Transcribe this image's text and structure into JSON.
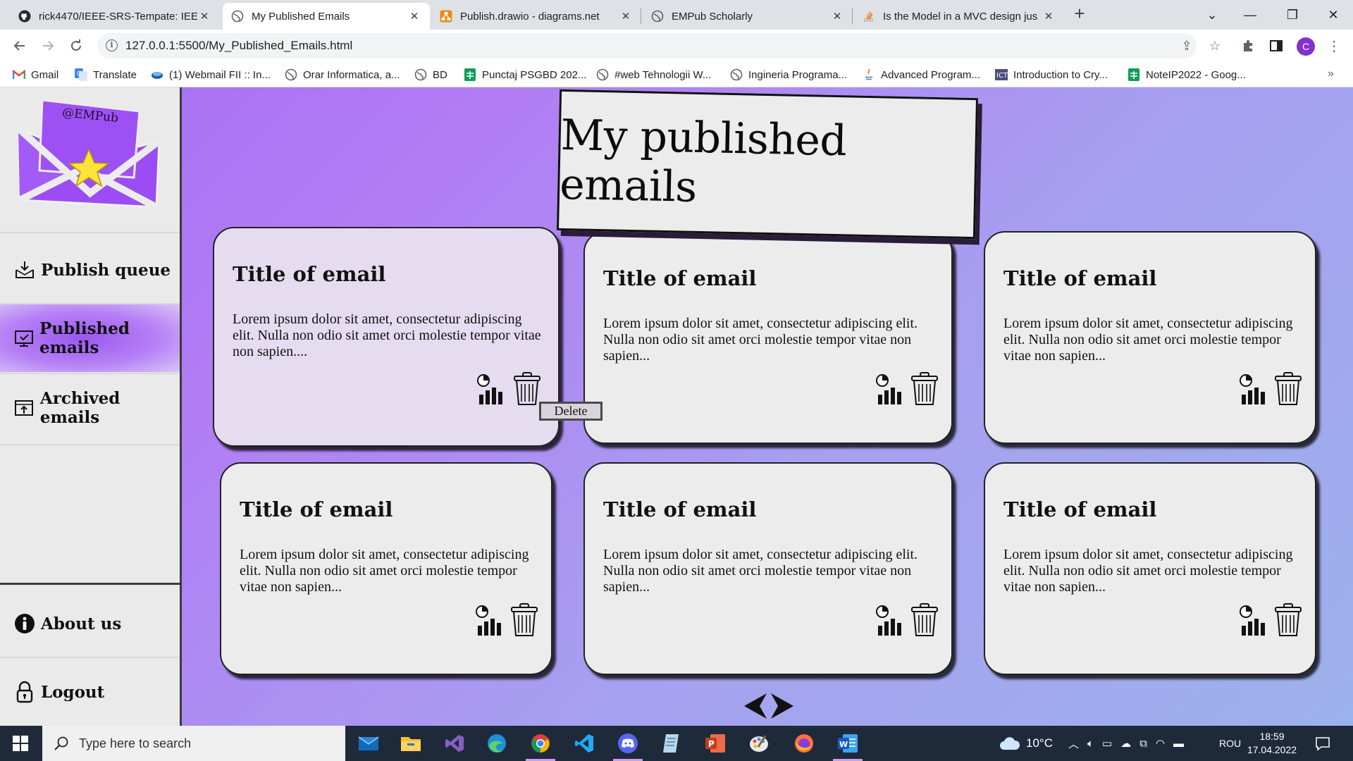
{
  "browser": {
    "tabs": [
      {
        "title": "rick4470/IEEE-SRS-Tempate: IEEE",
        "active": false,
        "icon": "github-icon"
      },
      {
        "title": "My Published Emails",
        "active": true,
        "icon": "globe-icon"
      },
      {
        "title": "Publish.drawio - diagrams.net",
        "active": false,
        "icon": "drawio-icon"
      },
      {
        "title": "EMPub Scholarly",
        "active": false,
        "icon": "globe-icon"
      },
      {
        "title": "Is the Model in a MVC design jus",
        "active": false,
        "icon": "stackoverflow-icon"
      }
    ],
    "url": "127.0.0.1:5500/My_Published_Emails.html",
    "profile_initial": "C",
    "bookmarks": [
      {
        "label": "Gmail",
        "icon": "gmail-icon"
      },
      {
        "label": "Translate",
        "icon": "translate-icon"
      },
      {
        "label": "(1) Webmail FII :: In...",
        "icon": "webmail-icon"
      },
      {
        "label": "Orar Informatica, a...",
        "icon": "globe-icon"
      },
      {
        "label": "BD",
        "icon": "globe-icon"
      },
      {
        "label": "Punctaj PSGBD 202...",
        "icon": "sheets-icon"
      },
      {
        "label": "#web Tehnologii W...",
        "icon": "globe-icon"
      },
      {
        "label": "Ingineria Programa...",
        "icon": "globe-icon"
      },
      {
        "label": "Advanced Program...",
        "icon": "java-icon"
      },
      {
        "label": "Introduction to Cry...",
        "icon": "crypto-icon"
      },
      {
        "label": "NoteIP2022 - Goog...",
        "icon": "sheets-icon"
      }
    ]
  },
  "app": {
    "logo_text": "@EMPub",
    "page_title": "My published emails",
    "sidebar": {
      "nav": [
        {
          "label": "Publish queue",
          "icon": "inbox-download-icon",
          "active": false
        },
        {
          "label": "Published emails",
          "icon": "monitor-check-icon",
          "active": true
        },
        {
          "label": "Archived emails",
          "icon": "archive-upload-icon",
          "active": false
        }
      ],
      "bottom": [
        {
          "label": "About us",
          "icon": "info-icon"
        },
        {
          "label": "Logout",
          "icon": "lock-icon"
        }
      ]
    },
    "cards": [
      {
        "title": "Title of email",
        "body": "Lorem ipsum dolor sit amet, consectetur adipiscing elit. Nulla non odio sit amet orci molestie tempor vitae non sapien....",
        "hovered": true
      },
      {
        "title": "Title of email",
        "body": "Lorem ipsum dolor sit amet, consectetur adipiscing elit. Nulla non odio sit amet orci molestie tempor vitae non sapien...",
        "hovered": false
      },
      {
        "title": "Title of email",
        "body": "Lorem ipsum dolor sit amet, consectetur adipiscing elit. Nulla non odio sit amet orci molestie tempor vitae non sapien...",
        "hovered": false
      },
      {
        "title": "Title of email",
        "body": "Lorem ipsum dolor sit amet, consectetur adipiscing elit. Nulla non odio sit amet orci molestie tempor vitae non sapien...",
        "hovered": false
      },
      {
        "title": "Title of email",
        "body": "Lorem ipsum dolor sit amet, consectetur adipiscing elit. Nulla non odio sit amet orci molestie tempor vitae non sapien...",
        "hovered": false
      },
      {
        "title": "Title of email",
        "body": "Lorem ipsum dolor sit amet, consectetur adipiscing elit. Nulla non odio sit amet orci molestie tempor vitae non sapien...",
        "hovered": false
      }
    ],
    "delete_tooltip": "Delete"
  },
  "taskbar": {
    "search_placeholder": "Type here to search",
    "apps": [
      "mail-icon",
      "file-explorer-icon",
      "visual-studio-icon",
      "edge-icon",
      "chrome-icon",
      "vscode-icon",
      "discord-icon",
      "notepad-icon",
      "powerpoint-icon",
      "paint-icon",
      "firefox-icon",
      "word-icon"
    ],
    "weather": "10°C",
    "language": "ROU",
    "time": "18:59",
    "date": "17.04.2022"
  },
  "colors": {
    "accent_purple": "#a56ef6",
    "card_bg": "#ececec",
    "sidebar_bg": "#eaeaea"
  }
}
